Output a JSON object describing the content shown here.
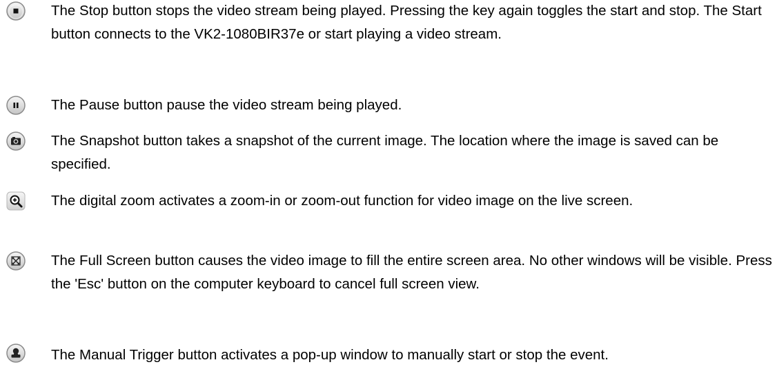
{
  "entries": [
    {
      "icon": "stop-icon",
      "text": "The Stop button stops the video stream being played. Pressing the key again toggles the start and stop. The Start button connects to the VK2-1080BIR37e or start playing a video stream."
    },
    {
      "icon": "pause-icon",
      "text": "The Pause button pause the video stream being played."
    },
    {
      "icon": "camera-icon",
      "text": "The Snapshot button takes a snapshot of the current image. The location where the image is saved can be specified."
    },
    {
      "icon": "zoom-in-icon",
      "text": "The digital zoom activates a zoom-in or zoom-out function for video image on the live screen."
    },
    {
      "icon": "fullscreen-icon",
      "text": "The Full Screen button causes the video image to fill the entire screen area. No other windows will be visible. Press the 'Esc' button on the computer keyboard to cancel full screen view."
    },
    {
      "icon": "manual-trigger-icon",
      "text": "The Manual Trigger button activates a pop-up window to manually start or stop the event."
    }
  ],
  "colors": {
    "icon_fill_top": "#f4f4f4",
    "icon_fill_bottom": "#c9c9c9",
    "icon_border": "#8a8a8a",
    "glyph": "#111111",
    "text": "#000000"
  }
}
